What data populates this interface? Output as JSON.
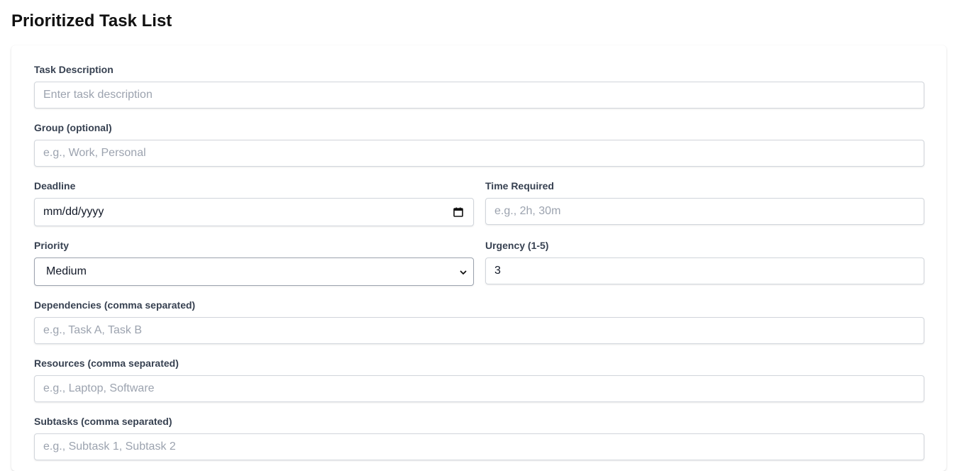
{
  "page": {
    "title": "Prioritized Task List"
  },
  "form": {
    "task_description": {
      "label": "Task Description",
      "placeholder": "Enter task description",
      "value": ""
    },
    "group": {
      "label": "Group (optional)",
      "placeholder": "e.g., Work, Personal",
      "value": ""
    },
    "deadline": {
      "label": "Deadline",
      "display": "mm/dd/yyyy",
      "icon": "calendar-icon"
    },
    "time_required": {
      "label": "Time Required",
      "placeholder": "e.g., 2h, 30m",
      "value": ""
    },
    "priority": {
      "label": "Priority",
      "selected": "Medium",
      "icon": "chevron-down-icon"
    },
    "urgency": {
      "label": "Urgency (1-5)",
      "value": "3"
    },
    "dependencies": {
      "label": "Dependencies (comma separated)",
      "placeholder": "e.g., Task A, Task B",
      "value": ""
    },
    "resources": {
      "label": "Resources (comma separated)",
      "placeholder": "e.g., Laptop, Software",
      "value": ""
    },
    "subtasks": {
      "label": "Subtasks (comma separated)",
      "placeholder": "e.g., Subtask 1, Subtask 2",
      "value": ""
    }
  },
  "colors": {
    "label": "#374151",
    "placeholder": "#9ca3af",
    "border": "#d1d5db"
  }
}
